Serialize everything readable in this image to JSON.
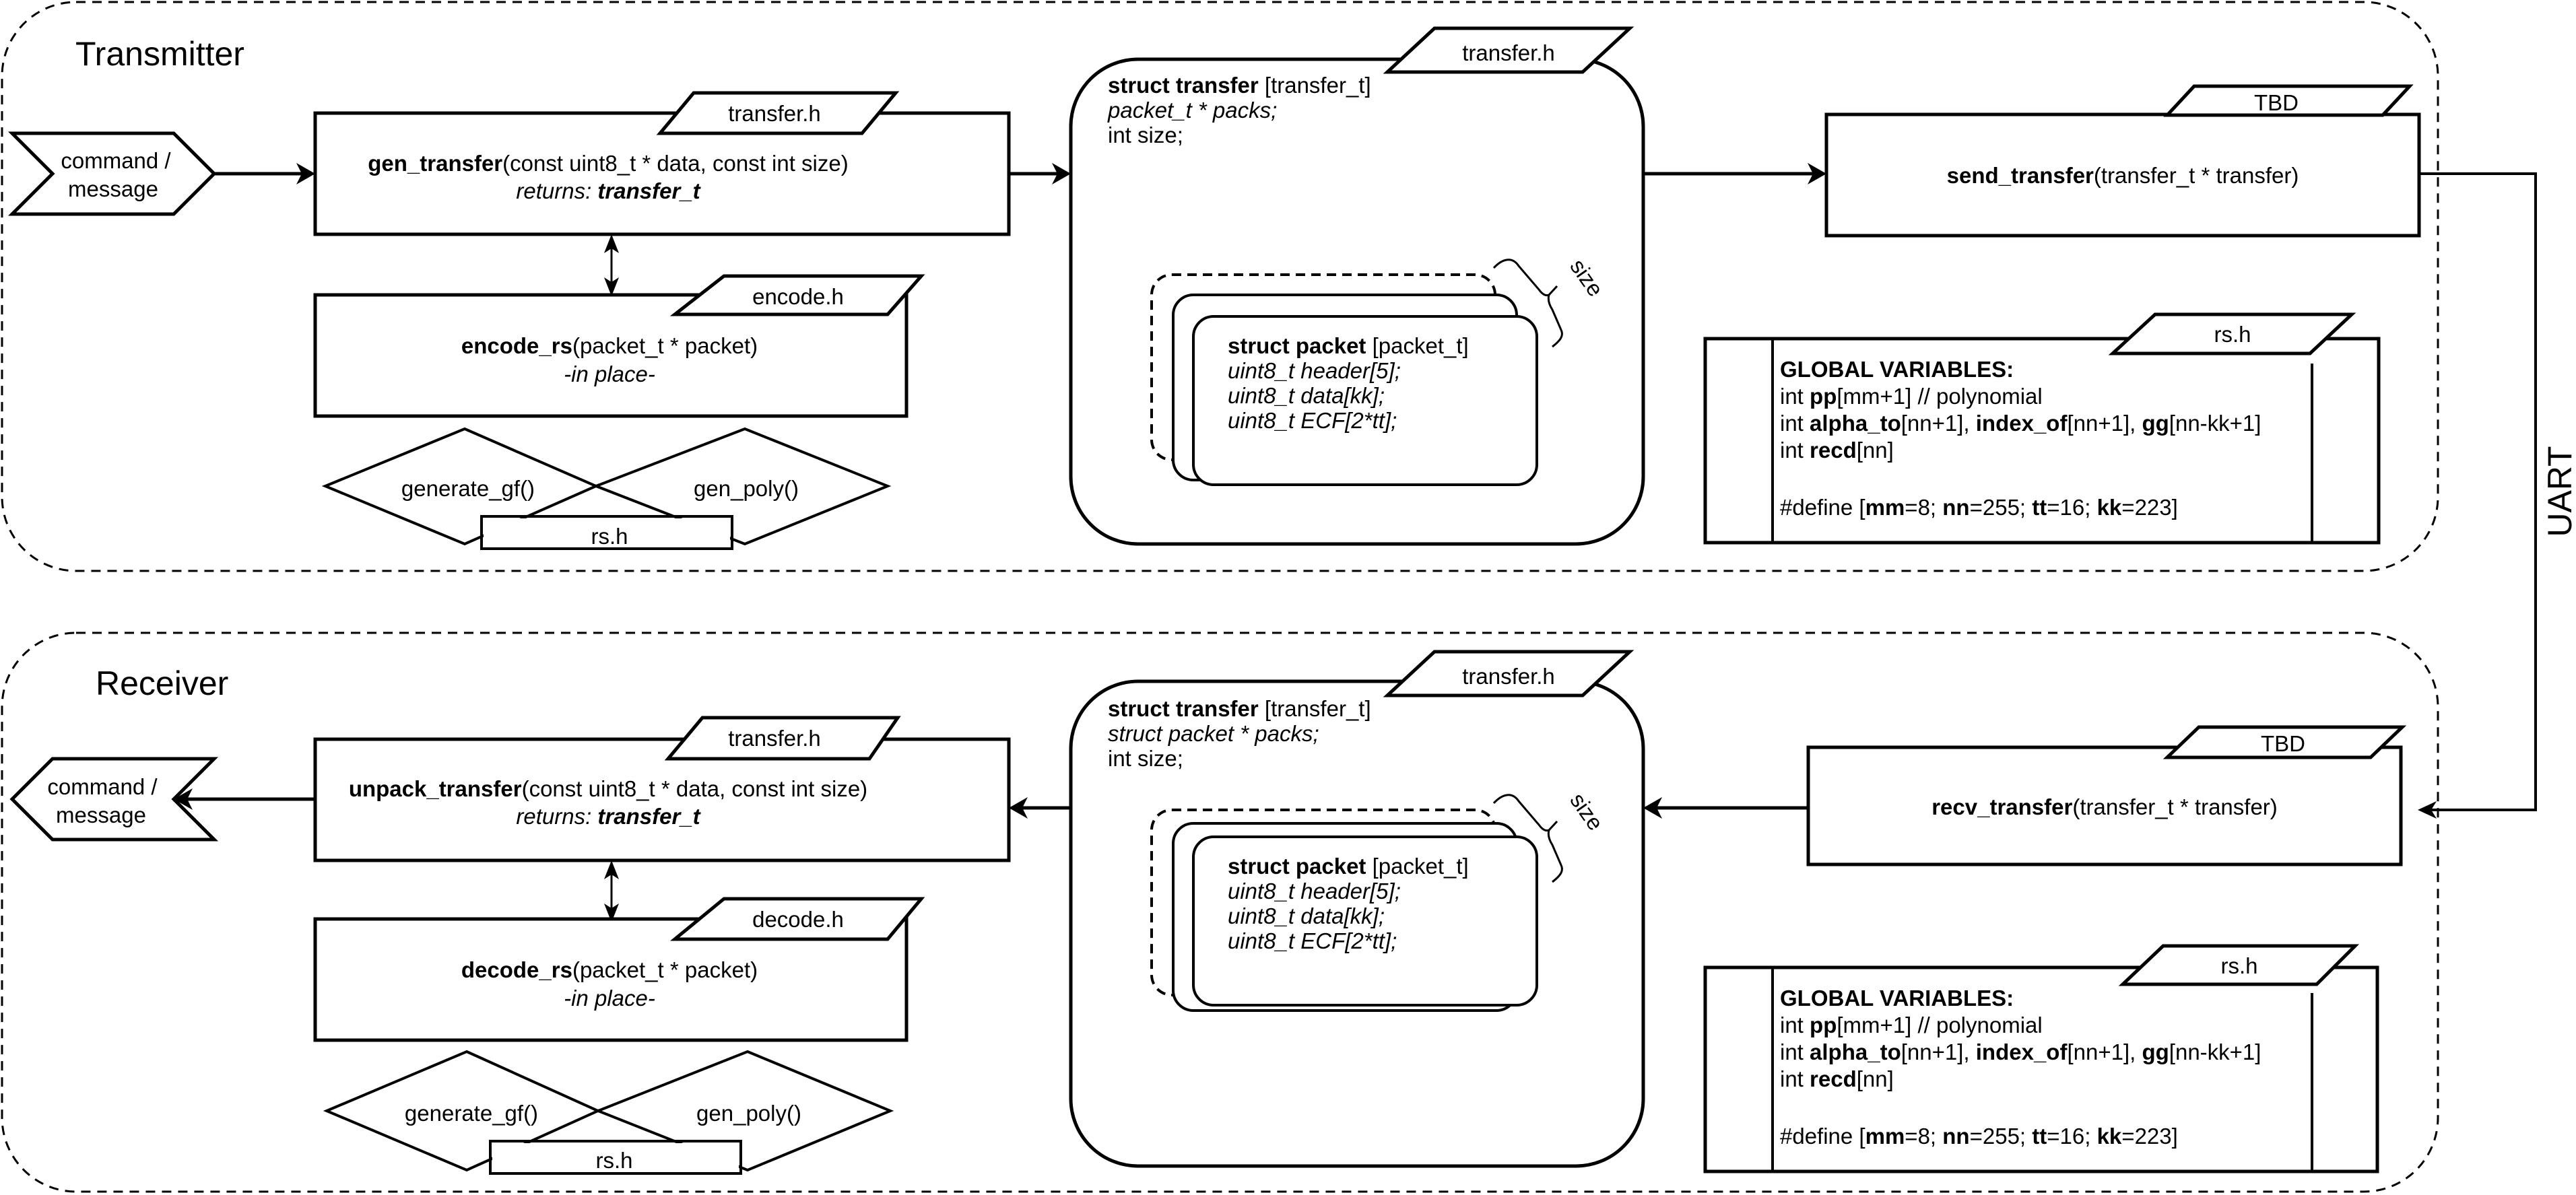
{
  "colors": {
    "stroke": "#000000",
    "background": "#ffffff"
  },
  "transmitter": {
    "title": "Transmitter",
    "input": {
      "line1": "command /",
      "line2": "message"
    },
    "gen_transfer": {
      "tag": "transfer.h",
      "fn_name": "gen_transfer",
      "fn_args": "(const uint8_t * data, const int size)",
      "returns_label": "returns: ",
      "returns_type": "transfer_t"
    },
    "encode_rs": {
      "tag": "encode.h",
      "fn_name": "encode_rs",
      "fn_args": "(packet_t * packet)",
      "note": "-in place-"
    },
    "rs_helpers": {
      "left": "generate_gf()",
      "right": "gen_poly()",
      "tag": "rs.h"
    },
    "struct_transfer": {
      "tag": "transfer.h",
      "title_bold": "struct transfer",
      "title_rest": " [transfer_t]",
      "field1": "packet_t * packs;",
      "field2": "int size;",
      "brace_label": "size",
      "packet": {
        "title_bold": "struct packet",
        "title_rest": " [packet_t]",
        "fields": [
          "uint8_t header[5];",
          "uint8_t data[kk];",
          "uint8_t ECF[2*tt];"
        ]
      }
    },
    "send_transfer": {
      "tag": "TBD",
      "fn_name": "send_transfer",
      "fn_args": "(transfer_t * transfer)"
    },
    "globals": {
      "tag": "rs.h",
      "heading": "GLOBAL VARIABLES:",
      "l1": [
        "int ",
        "pp",
        "[mm+1] // polynomial"
      ],
      "l2": [
        "int ",
        "alpha_to",
        "[nn+1], ",
        "index_of",
        "[nn+1], ",
        "gg",
        "[nn-kk+1]"
      ],
      "l3": [
        "int ",
        "recd",
        "[nn]"
      ],
      "l4": [
        "#define [",
        "mm",
        "=8; ",
        "nn",
        "=255; ",
        "tt",
        "=16; ",
        "kk",
        "=223]"
      ]
    }
  },
  "link": {
    "label": "UART"
  },
  "receiver": {
    "title": "Receiver",
    "output": {
      "line1": "command /",
      "line2": "message"
    },
    "unpack_transfer": {
      "tag": "transfer.h",
      "fn_name": "unpack_transfer",
      "fn_args": "(const uint8_t * data, const int size)",
      "returns_label": "returns: ",
      "returns_type": "transfer_t"
    },
    "decode_rs": {
      "tag": "decode.h",
      "fn_name": "decode_rs",
      "fn_args": "(packet_t * packet)",
      "note": "-in place-"
    },
    "rs_helpers": {
      "left": "generate_gf()",
      "right": "gen_poly()",
      "tag": "rs.h"
    },
    "struct_transfer": {
      "tag": "transfer.h",
      "title_bold": "struct transfer",
      "title_rest": " [transfer_t]",
      "field1": "struct packet * packs;",
      "field2": "int size;",
      "brace_label": "size",
      "packet": {
        "title_bold": "struct packet",
        "title_rest": " [packet_t]",
        "fields": [
          "uint8_t header[5];",
          "uint8_t data[kk];",
          "uint8_t ECF[2*tt];"
        ]
      }
    },
    "recv_transfer": {
      "tag": "TBD",
      "fn_name": "recv_transfer",
      "fn_args": "(transfer_t * transfer)"
    },
    "globals": {
      "tag": "rs.h",
      "heading": "GLOBAL VARIABLES:",
      "l1": [
        "int ",
        "pp",
        "[mm+1] // polynomial"
      ],
      "l2": [
        "int ",
        "alpha_to",
        "[nn+1], ",
        "index_of",
        "[nn+1], ",
        "gg",
        "[nn-kk+1]"
      ],
      "l3": [
        "int ",
        "recd",
        "[nn]"
      ],
      "l4": [
        "#define [",
        "mm",
        "=8; ",
        "nn",
        "=255; ",
        "tt",
        "=16; ",
        "kk",
        "=223]"
      ]
    }
  }
}
